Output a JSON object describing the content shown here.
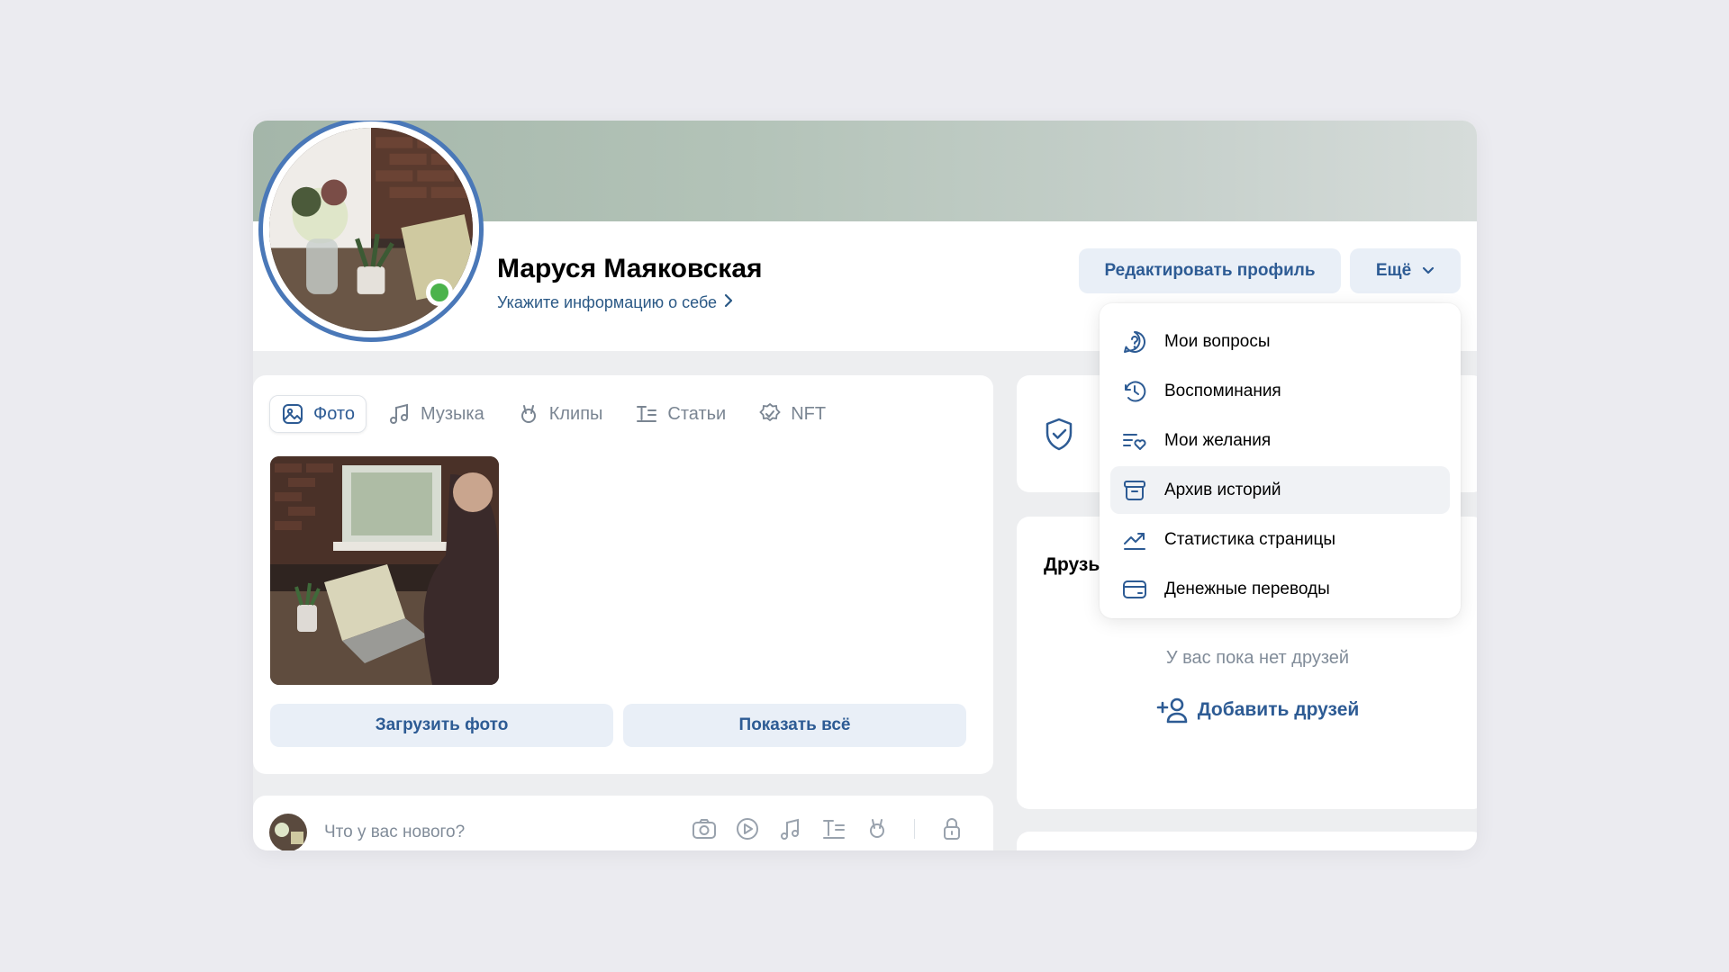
{
  "profile": {
    "name": "Маруся Маяковская",
    "about_link": "Укажите информацию о себе",
    "edit_button": "Редактировать профиль",
    "more_button": "Ещё"
  },
  "dropdown": {
    "items": [
      {
        "label": "Мои вопросы",
        "icon": "question-icon"
      },
      {
        "label": "Воспоминания",
        "icon": "history-icon"
      },
      {
        "label": "Мои желания",
        "icon": "wishlist-icon"
      },
      {
        "label": "Архив историй",
        "icon": "archive-icon"
      },
      {
        "label": "Статистика страницы",
        "icon": "stats-icon"
      },
      {
        "label": "Денежные переводы",
        "icon": "card-icon"
      }
    ],
    "hovered_index": 3
  },
  "media": {
    "tabs": [
      {
        "label": "Фото",
        "icon": "photo-icon",
        "active": true
      },
      {
        "label": "Музыка",
        "icon": "music-icon"
      },
      {
        "label": "Клипы",
        "icon": "clips-icon"
      },
      {
        "label": "Статьи",
        "icon": "articles-icon"
      },
      {
        "label": "NFT",
        "icon": "nft-icon"
      }
    ],
    "upload_button": "Загрузить фото",
    "show_all_button": "Показать всё"
  },
  "post": {
    "placeholder": "Что у вас нового?"
  },
  "friends": {
    "title": "Друзья",
    "empty_text": "У вас пока нет друзей",
    "add_button": "Добавить друзей"
  },
  "colors": {
    "accent": "#2d5b94",
    "button_bg": "#e9eff7",
    "online": "#4bb34b",
    "avatar_ring": "#4a78b8"
  }
}
